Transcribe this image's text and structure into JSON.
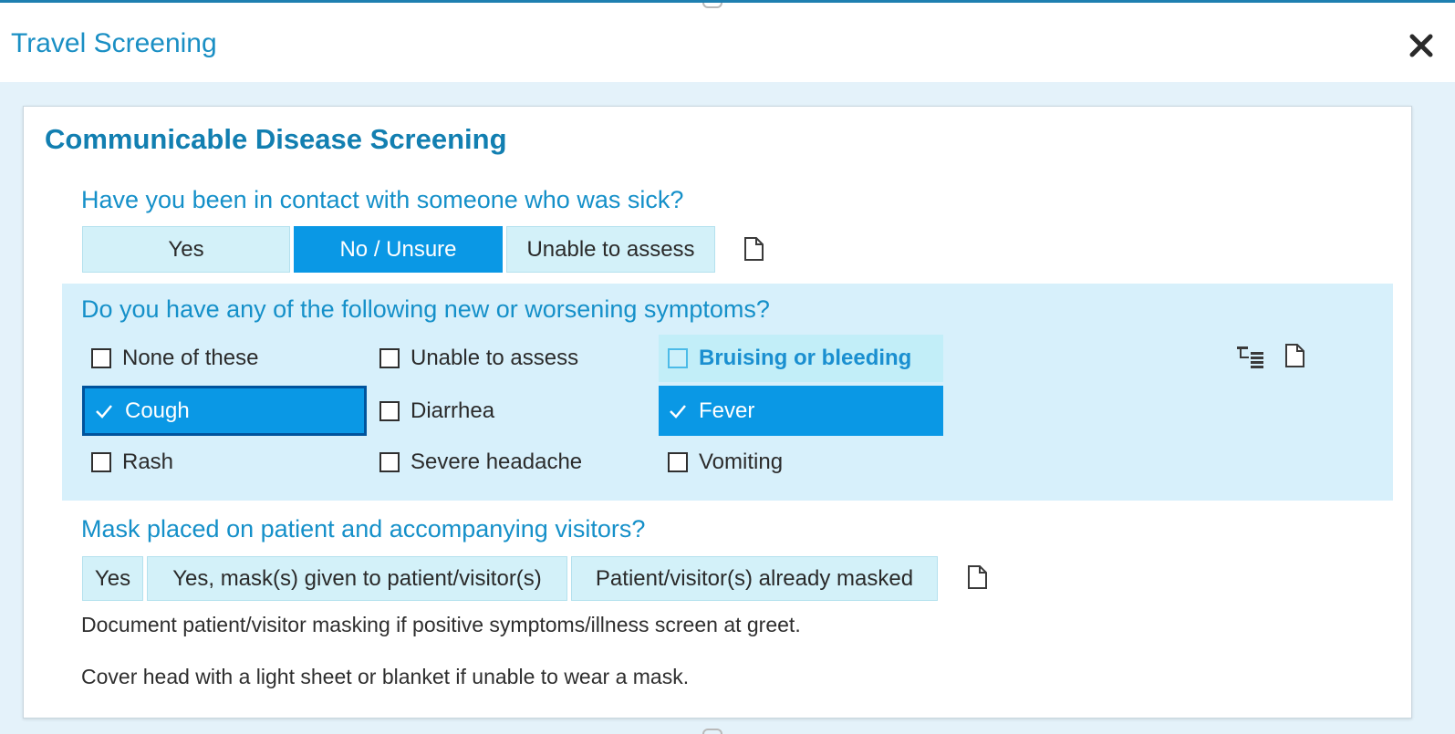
{
  "window": {
    "title": "Travel Screening"
  },
  "section": {
    "title": "Communicable Disease Screening"
  },
  "q_contact": {
    "question": "Have you been in contact with someone who was sick?",
    "options": [
      "Yes",
      "No / Unsure",
      "Unable to assess"
    ],
    "selected": "No / Unsure"
  },
  "q_symptoms": {
    "question": "Do you have any of the following new or worsening symptoms?",
    "options": [
      {
        "label": "None of these",
        "checked": false
      },
      {
        "label": "Unable to assess",
        "checked": false
      },
      {
        "label": "Bruising or bleeding",
        "checked": false,
        "highlighted": true
      },
      {
        "label": "Cough",
        "checked": true,
        "focused": true
      },
      {
        "label": "Diarrhea",
        "checked": false
      },
      {
        "label": "Fever",
        "checked": true
      },
      {
        "label": "Rash",
        "checked": false
      },
      {
        "label": "Severe headache",
        "checked": false
      },
      {
        "label": "Vomiting",
        "checked": false
      }
    ]
  },
  "q_mask": {
    "question": "Mask placed on patient and accompanying visitors?",
    "options": [
      "Yes",
      "Yes, mask(s) given to patient/visitor(s)",
      "Patient/visitor(s) already masked"
    ],
    "selected": null
  },
  "hints": [
    "Document patient/visitor masking if positive symptoms/illness screen at greet.",
    "Cover head with a light sheet or blanket if unable to wear a mask."
  ],
  "icons": {
    "close": "close-icon",
    "note": "note-icon",
    "list_tree": "list-tree-icon",
    "check": "checkmark-icon"
  },
  "colors": {
    "accent": "#0a98e5",
    "title_text": "#127fb1",
    "question_text": "#1590c9",
    "button_bg": "#d3f1f9",
    "band_bg": "#d7f0fb"
  }
}
